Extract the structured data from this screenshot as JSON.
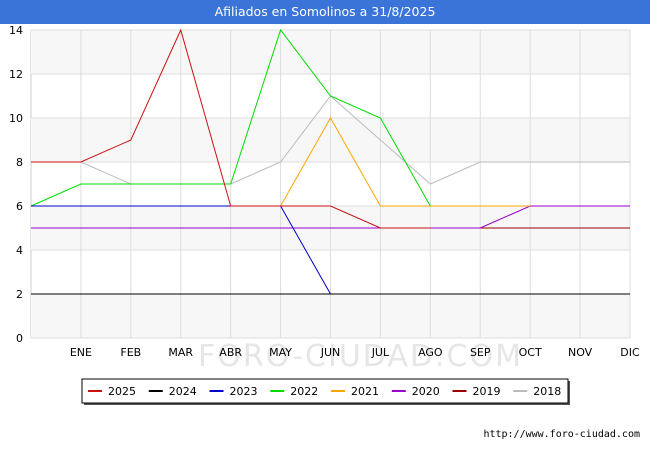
{
  "header": {
    "title": "Afiliados en Somolinos a 31/8/2025"
  },
  "footer": {
    "url": "http://www.foro-ciudad.com"
  },
  "watermark": "FORO-CIUDAD.COM",
  "chart_data": {
    "type": "line",
    "title": "Afiliados en Somolinos a 31/8/2025",
    "xlabel": "",
    "ylabel": "",
    "categories": [
      "ENE",
      "FEB",
      "MAR",
      "ABR",
      "MAY",
      "JUN",
      "JUL",
      "AGO",
      "SEP",
      "OCT",
      "NOV",
      "DIC"
    ],
    "ylim": [
      0,
      14
    ],
    "yticks": [
      0,
      2,
      4,
      6,
      8,
      10,
      12,
      14
    ],
    "grid": true,
    "legend_position": "bottom",
    "series": [
      {
        "name": "2025",
        "color": "#cc1111",
        "x": [
          0,
          1,
          2,
          3,
          4,
          5,
          6,
          7,
          8
        ],
        "values": [
          8,
          8,
          9,
          14,
          6,
          6,
          6,
          5,
          5
        ]
      },
      {
        "name": "2024",
        "color": "#000000",
        "x": [
          0,
          1,
          2,
          3,
          4,
          5,
          6,
          7,
          8,
          9,
          10,
          11,
          12
        ],
        "values": [
          2,
          2,
          2,
          2,
          2,
          2,
          2,
          2,
          2,
          2,
          2,
          2,
          2
        ]
      },
      {
        "name": "2023",
        "color": "#0000cc",
        "x": [
          0,
          1,
          2,
          3,
          4,
          5,
          6,
          7,
          8,
          9,
          10,
          11,
          12
        ],
        "values": [
          6,
          6,
          6,
          6,
          6,
          6,
          2,
          2,
          2,
          2,
          2,
          2,
          2
        ]
      },
      {
        "name": "2022",
        "color": "#00dd00",
        "x": [
          0,
          1,
          2,
          3,
          4,
          5,
          6,
          7,
          8
        ],
        "values": [
          6,
          7,
          7,
          7,
          7,
          14,
          11,
          10,
          6
        ]
      },
      {
        "name": "2021",
        "color": "#ffa500",
        "x": [
          0,
          1,
          2,
          3,
          4,
          5,
          6,
          7,
          8,
          9,
          10
        ],
        "values": [
          6,
          6,
          6,
          6,
          6,
          6,
          10,
          6,
          6,
          6,
          6
        ]
      },
      {
        "name": "2020",
        "color": "#9900cc",
        "x": [
          0,
          1,
          2,
          3,
          4,
          5,
          6,
          7,
          8,
          9,
          10,
          11,
          12
        ],
        "values": [
          5,
          5,
          5,
          5,
          5,
          5,
          5,
          5,
          5,
          5,
          6,
          6,
          6
        ]
      },
      {
        "name": "2019",
        "color": "#990000",
        "x": [
          0,
          1,
          2,
          3,
          4,
          5,
          6,
          7,
          8,
          9,
          10,
          11,
          12
        ],
        "values": [
          5,
          5,
          5,
          5,
          5,
          5,
          5,
          5,
          5,
          5,
          5,
          5,
          5
        ]
      },
      {
        "name": "2018",
        "color": "#bbbbbb",
        "x": [
          0,
          1,
          2,
          3,
          4,
          5,
          6,
          7,
          8,
          9,
          10,
          11,
          12
        ],
        "values": [
          8,
          8,
          7,
          7,
          7,
          8,
          11,
          9,
          7,
          8,
          8,
          8,
          8
        ]
      }
    ]
  }
}
